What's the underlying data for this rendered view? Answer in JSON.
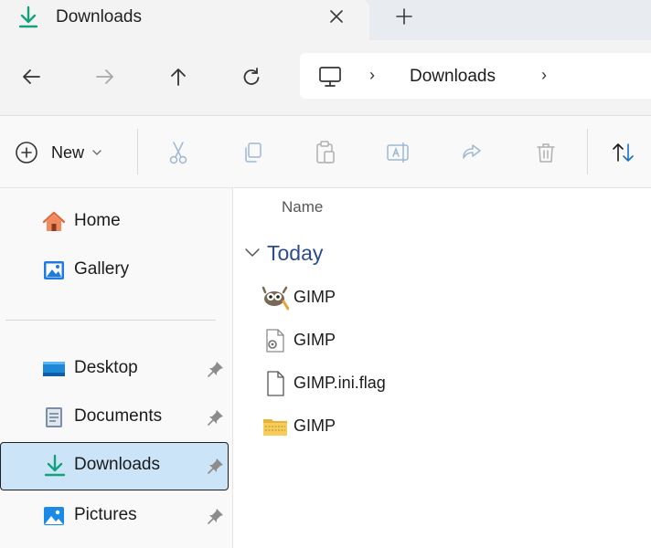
{
  "tab": {
    "title": "Downloads",
    "close_icon": "close-icon",
    "new_tab_icon": "plus-icon"
  },
  "nav": {
    "back_icon": "arrow-left-icon",
    "forward_icon": "arrow-right-icon",
    "up_icon": "arrow-up-icon",
    "refresh_icon": "refresh-icon",
    "breadcrumb": [
      {
        "icon": "this-pc-icon"
      },
      {
        "label": "Downloads"
      }
    ],
    "separator": "›"
  },
  "toolbar": {
    "new_label": "New",
    "new_chevron": "⌄",
    "buttons": [
      "cut-icon",
      "copy-icon",
      "paste-icon",
      "rename-icon",
      "share-icon",
      "delete-icon",
      "sort-icon"
    ]
  },
  "sidebar": {
    "items": [
      {
        "label": "Home",
        "icon": "home-icon"
      },
      {
        "label": "Gallery",
        "icon": "gallery-icon"
      },
      {
        "label": "Desktop",
        "icon": "desktop-folder-icon",
        "pinned": true
      },
      {
        "label": "Documents",
        "icon": "documents-folder-icon",
        "pinned": true
      },
      {
        "label": "Downloads",
        "icon": "downloads-icon",
        "pinned": true,
        "selected": true
      },
      {
        "label": "Pictures",
        "icon": "pictures-folder-icon",
        "pinned": true
      }
    ]
  },
  "content": {
    "column_name": "Name",
    "group": "Today",
    "files": [
      {
        "name": "GIMP",
        "icon": "gimp-app-icon"
      },
      {
        "name": "GIMP",
        "icon": "settings-file-icon"
      },
      {
        "name": "GIMP.ini.flag",
        "icon": "blank-file-icon"
      },
      {
        "name": "GIMP",
        "icon": "zip-folder-icon"
      }
    ]
  },
  "colors": {
    "accent": "#0078d4",
    "group_header": "#2d4c8c",
    "selection": "#cce4f7",
    "download_green": "#12a37d"
  }
}
